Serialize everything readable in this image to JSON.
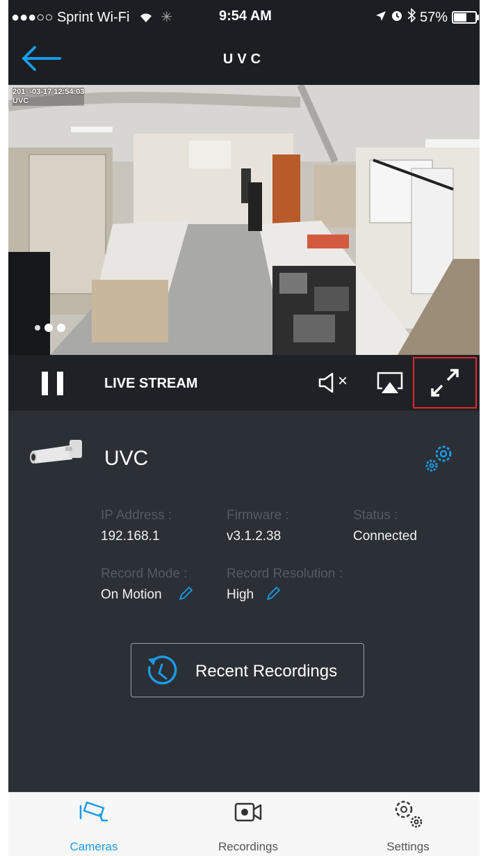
{
  "status_bar": {
    "carrier": "●●●○○ Sprint Wi-Fi",
    "time": "9:54 AM",
    "battery": "57%",
    "battery_level": 0.57
  },
  "nav": {
    "title": "UVC"
  },
  "video": {
    "timestamp": "201_-03-17 12:54:03",
    "camera_label": "UVC"
  },
  "controls": {
    "live_label": "LIVE STREAM",
    "mute_symbol": "×"
  },
  "camera": {
    "name": "UVC",
    "fields": {
      "ip_label": "IP Address :",
      "ip_value": "192.168.1",
      "firmware_label": "Firmware :",
      "firmware_value": "v3.1.2.38",
      "status_label": "Status :",
      "status_value": "Connected",
      "record_mode_label": "Record Mode :",
      "record_mode_value": "On Motion",
      "record_resolution_label": "Record Resolution :",
      "record_resolution_value": "High"
    }
  },
  "recent_button": {
    "label": "Recent Recordings"
  },
  "tabs": [
    {
      "label": "Cameras",
      "icon": "security-camera-icon",
      "active": true
    },
    {
      "label": "Recordings",
      "icon": "video-camera-icon",
      "active": false
    },
    {
      "label": "Settings",
      "icon": "gears-icon",
      "active": false
    }
  ],
  "colors": {
    "accent": "#1a9be8",
    "highlight_border": "#e8262e",
    "panel_bg": "#2b2f36"
  }
}
